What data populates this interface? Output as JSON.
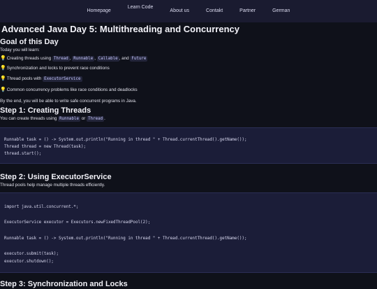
{
  "nav": {
    "items": [
      "Homepage",
      "Learn Code",
      "About us",
      "Contakt",
      "Partner",
      "German"
    ],
    "active_index": 1
  },
  "main": {
    "title": "Advanced Java Day 5: Multithreading and Concurrency",
    "goal_heading": "Goal of this Day",
    "intro": "Today you will learn:",
    "bullets": [
      {
        "pre": "Creating threads using ",
        "codes": [
          "Thread",
          "Runnable",
          "Callable"
        ],
        "and": ", and ",
        "last": "Future"
      },
      {
        "text": "Synchronization and locks to prevent race conditions"
      },
      {
        "pre": "Thread pools with ",
        "code": "ExecutorService"
      },
      {
        "text": "Common concurrency problems like race conditions and deadlocks"
      }
    ],
    "bullet_icon": "lightbulb-icon",
    "outro": "By the end, you will be able to write safe concurrent programs in Java.",
    "step1": {
      "heading": "Step 1: Creating Threads",
      "text_pre": "You can create threads using ",
      "code1": "Runnable",
      "text_mid": " or ",
      "code2": "Thread",
      "text_post": ".",
      "code": "Runnable task = () -> System.out.println(\"Running in thread \" + Thread.currentThread().getName());\nThread thread = new Thread(task);\nthread.start();"
    },
    "step2": {
      "heading": "Step 2: Using ExecutorService",
      "text": "Thread pools help manage multiple threads efficiently.",
      "code": "import java.util.concurrent.*;\n\nExecutorService executor = Executors.newFixedThreadPool(2);\n\nRunnable task = () -> System.out.println(\"Running in thread \" + Thread.currentThread().getName());\n\nexecutor.submit(task);\nexecutor.shutdown();"
    },
    "step3": {
      "heading": "Step 3: Synchronization and Locks"
    }
  },
  "colors": {
    "background": "#0f111a",
    "nav_bg": "#1a1b30",
    "code_bg": "#1b1d38",
    "inline_code_bg": "#23253a",
    "bulb": "#ffd74d"
  }
}
